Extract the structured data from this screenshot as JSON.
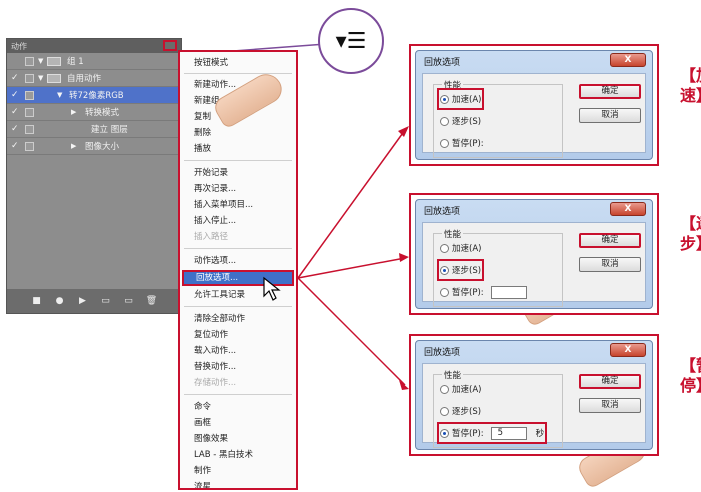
{
  "panel": {
    "tab": "动作",
    "rows": [
      {
        "check": "",
        "label": "组 1"
      },
      {
        "check": "✓",
        "label": "自用动作"
      },
      {
        "check": "✓",
        "label": "转72像素RGB"
      },
      {
        "check": "✓",
        "label": "转换模式"
      },
      {
        "check": "✓",
        "label": "建立 图层"
      },
      {
        "check": "✓",
        "label": "图像大小"
      }
    ],
    "footer_icons": [
      "■",
      "●",
      "▶",
      "▭",
      "▭",
      "🗑"
    ]
  },
  "bubble": {
    "icon": "▾☰"
  },
  "menu": {
    "items": [
      {
        "label": "按钮模式"
      },
      {
        "label": "新建动作..."
      },
      {
        "label": "新建组..."
      },
      {
        "label": "复制"
      },
      {
        "label": "删除"
      },
      {
        "label": "播放"
      },
      {
        "label": "开始记录"
      },
      {
        "label": "再次记录..."
      },
      {
        "label": "插入菜单项目..."
      },
      {
        "label": "插入停止..."
      },
      {
        "label": "插入路径"
      },
      {
        "label": "动作选项..."
      },
      {
        "label": "回放选项..."
      },
      {
        "label": "允许工具记录"
      },
      {
        "label": "清除全部动作"
      },
      {
        "label": "复位动作"
      },
      {
        "label": "载入动作..."
      },
      {
        "label": "替换动作..."
      },
      {
        "label": "存储动作..."
      },
      {
        "label": "命令"
      },
      {
        "label": "画框"
      },
      {
        "label": "图像效果"
      },
      {
        "label": "LAB - 黑白技术"
      },
      {
        "label": "制作"
      },
      {
        "label": "流星"
      }
    ]
  },
  "dialogs": [
    {
      "title": "回放选项",
      "close": "X",
      "group": "性能",
      "opt_accel": "加速(A)",
      "opt_step": "逐步(S)",
      "opt_pause": "暂停(P):",
      "selected": "accel",
      "seconds": "",
      "unit": "",
      "ok": "确定",
      "cancel": "取消",
      "side": "【加速】"
    },
    {
      "title": "回放选项",
      "close": "X",
      "group": "性能",
      "opt_accel": "加速(A)",
      "opt_step": "逐步(S)",
      "opt_pause": "暂停(P):",
      "selected": "step",
      "seconds": "",
      "unit": "",
      "ok": "确定",
      "cancel": "取消",
      "side": "【逐步】"
    },
    {
      "title": "回放选项",
      "close": "X",
      "group": "性能",
      "opt_accel": "加速(A)",
      "opt_step": "逐步(S)",
      "opt_pause": "暂停(P):",
      "selected": "pause",
      "seconds": "5",
      "unit": "秒",
      "ok": "确定",
      "cancel": "取消",
      "side": "【暂停】"
    }
  ],
  "colors": {
    "highlight_red": "#c8102e",
    "menu_select": "#3f70c8",
    "bubble_border": "#7b4b9a"
  }
}
